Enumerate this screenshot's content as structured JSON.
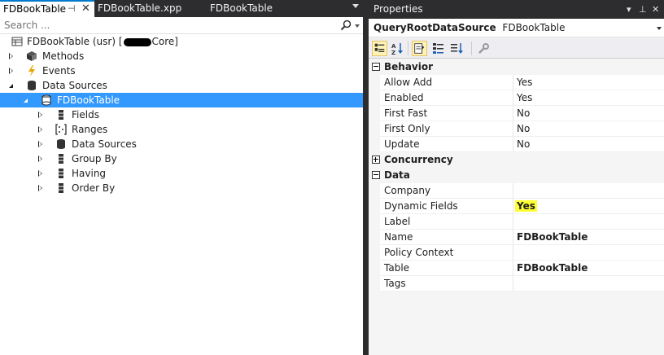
{
  "tabs": {
    "active": "FDBookTable",
    "pin_glyph": "⊣",
    "close_glyph": "✕",
    "second": "FDBookTable.xpp",
    "third": "FDBookTable"
  },
  "search": {
    "placeholder": "Search ..."
  },
  "tree": {
    "root": {
      "label": "FDBookTable (usr) [",
      "label_tail": "Core]"
    },
    "items": [
      {
        "label": "Methods",
        "icon": "methods-icon"
      },
      {
        "label": "Events",
        "icon": "lightning-icon"
      },
      {
        "label": "Data Sources",
        "icon": "datasource-icon"
      },
      {
        "label": "FDBookTable",
        "icon": "datasource-icon"
      },
      {
        "label": "Fields",
        "icon": "fields-icon"
      },
      {
        "label": "Ranges",
        "icon": "ranges-icon"
      },
      {
        "label": "Data Sources",
        "icon": "datasource-icon"
      },
      {
        "label": "Group By",
        "icon": "groupby-icon"
      },
      {
        "label": "Having",
        "icon": "having-icon"
      },
      {
        "label": "Order By",
        "icon": "orderby-icon"
      }
    ]
  },
  "properties": {
    "title": "Properties",
    "dropdown_glyph": "▾",
    "pin_glyph": "⊥",
    "close_glyph": "✕",
    "object_type": "QueryRootDataSource",
    "object_name": "FDBookTable",
    "categories": {
      "behavior": "Behavior",
      "concurrency": "Concurrency",
      "data": "Data"
    },
    "behavior_rows": [
      {
        "name": "Allow Add",
        "value": "Yes"
      },
      {
        "name": "Enabled",
        "value": "Yes"
      },
      {
        "name": "First Fast",
        "value": "No"
      },
      {
        "name": "First Only",
        "value": "No"
      },
      {
        "name": "Update",
        "value": "No"
      }
    ],
    "data_rows": [
      {
        "name": "Company",
        "value": ""
      },
      {
        "name": "Dynamic Fields",
        "value": "Yes"
      },
      {
        "name": "Label",
        "value": ""
      },
      {
        "name": "Name",
        "value": "FDBookTable"
      },
      {
        "name": "Policy Context",
        "value": ""
      },
      {
        "name": "Table",
        "value": "FDBookTable"
      },
      {
        "name": "Tags",
        "value": ""
      }
    ]
  },
  "colors": {
    "selection": "#3399ff",
    "highlight": "#ffff33",
    "accent": "#007acc",
    "chrome": "#2d2d30"
  }
}
